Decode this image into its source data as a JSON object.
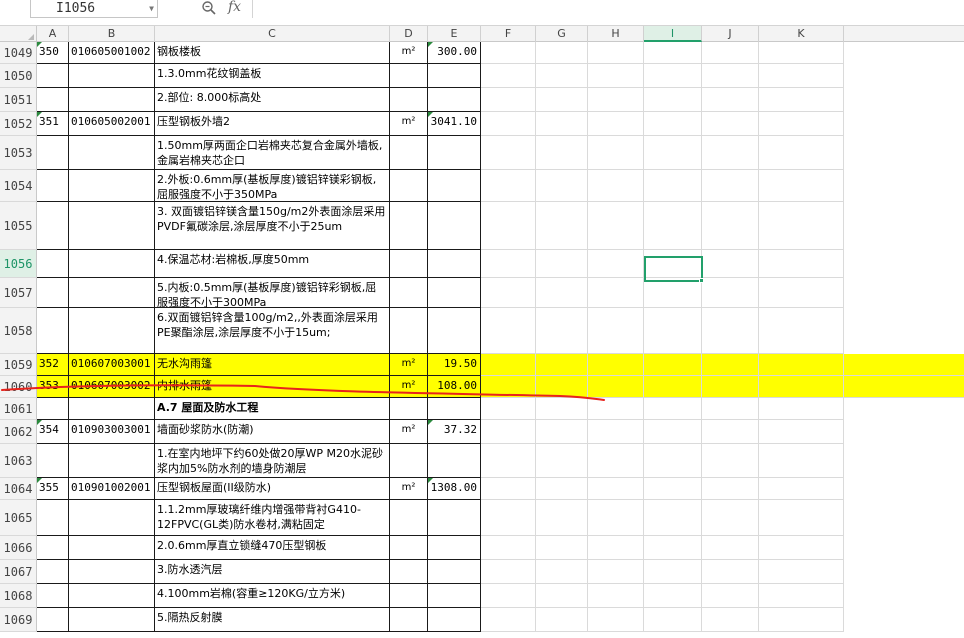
{
  "formula_bar": {
    "name_box": "I1056",
    "zoom_icon": "zoom-icon",
    "fx_label": "fx"
  },
  "columns": [
    "A",
    "B",
    "C",
    "D",
    "E",
    "F",
    "G",
    "H",
    "I",
    "J",
    "K"
  ],
  "selected_column": "I",
  "selected_row": "1056",
  "rows": [
    {
      "num": "1049",
      "a": "350",
      "b": "010605001002",
      "c": "钢板楼板",
      "d": "m²",
      "e": "300.00"
    },
    {
      "num": "1050",
      "a": "",
      "b": "",
      "c": "1.3.0mm花纹钢盖板",
      "d": "",
      "e": ""
    },
    {
      "num": "1051",
      "a": "",
      "b": "",
      "c": "2.部位: 8.000标高处",
      "d": "",
      "e": ""
    },
    {
      "num": "1052",
      "a": "351",
      "b": "010605002001",
      "c": "压型钢板外墙2",
      "d": "m²",
      "e": "3041.10"
    },
    {
      "num": "1053",
      "a": "",
      "b": "",
      "c": "1.50mm厚两面企口岩棉夹芯复合金属外墙板,金属岩棉夹芯企口",
      "d": "",
      "e": ""
    },
    {
      "num": "1054",
      "a": "",
      "b": "",
      "c": "2.外板:0.6mm厚(基板厚度)镀铝锌镁彩钢板,屈服强度不小于350MPa",
      "d": "",
      "e": ""
    },
    {
      "num": "1055",
      "a": "",
      "b": "",
      "c": "3. 双面镀铝锌镁含量150g/m2外表面涂层采用PVDF氟碳涂层,涂层厚度不小于25um",
      "d": "",
      "e": ""
    },
    {
      "num": "1056",
      "a": "",
      "b": "",
      "c": "4.保温芯材:岩棉板,厚度50mm",
      "d": "",
      "e": ""
    },
    {
      "num": "1057",
      "a": "",
      "b": "",
      "c": "5.内板:0.5mm厚(基板厚度)镀铝锌彩钢板,屈服强度不小于300MPa",
      "d": "",
      "e": ""
    },
    {
      "num": "1058",
      "a": "",
      "b": "",
      "c": "6.双面镀铝锌含量100g/m2,,外表面涂层采用PE聚酯涂层,涂层厚度不小于15um;",
      "d": "",
      "e": ""
    },
    {
      "num": "1059",
      "a": "352",
      "b": "010607003001",
      "c": "无水沟雨篷",
      "d": "m²",
      "e": "19.50"
    },
    {
      "num": "1060",
      "a": "353",
      "b": "010607003002",
      "c": "内排水雨篷",
      "d": "m²",
      "e": "108.00"
    },
    {
      "num": "1061",
      "a": "",
      "b": "",
      "c": "A.7 屋面及防水工程",
      "d": "",
      "e": ""
    },
    {
      "num": "1062",
      "a": "354",
      "b": "010903003001",
      "c": "墙面砂浆防水(防潮)",
      "d": "m²",
      "e": "37.32"
    },
    {
      "num": "1063",
      "a": "",
      "b": "",
      "c": "1.在室内地坪下约60处做20厚WP M20水泥砂浆内加5%防水剂的墙身防潮层",
      "d": "",
      "e": ""
    },
    {
      "num": "1064",
      "a": "355",
      "b": "010901002001",
      "c": "压型钢板屋面(II级防水)",
      "d": "m²",
      "e": "1308.00"
    },
    {
      "num": "1065",
      "a": "",
      "b": "",
      "c": "1.1.2mm厚玻璃纤维内增强带背衬G410-12FPVC(GL类)防水卷材,满粘固定",
      "d": "",
      "e": ""
    },
    {
      "num": "1066",
      "a": "",
      "b": "",
      "c": "2.0.6mm厚直立锁缝470压型钢板",
      "d": "",
      "e": ""
    },
    {
      "num": "1067",
      "a": "",
      "b": "",
      "c": "3.防水透汽层",
      "d": "",
      "e": ""
    },
    {
      "num": "1068",
      "a": "",
      "b": "",
      "c": "4.100mm岩棉(容重≥120KG/立方米)",
      "d": "",
      "e": ""
    },
    {
      "num": "1069",
      "a": "",
      "b": "",
      "c": "5.隔热反射膜",
      "d": "",
      "e": ""
    }
  ],
  "colors": {
    "highlight": "#ffff00",
    "selection": "#22a06b",
    "annotation": "#e8231c"
  }
}
